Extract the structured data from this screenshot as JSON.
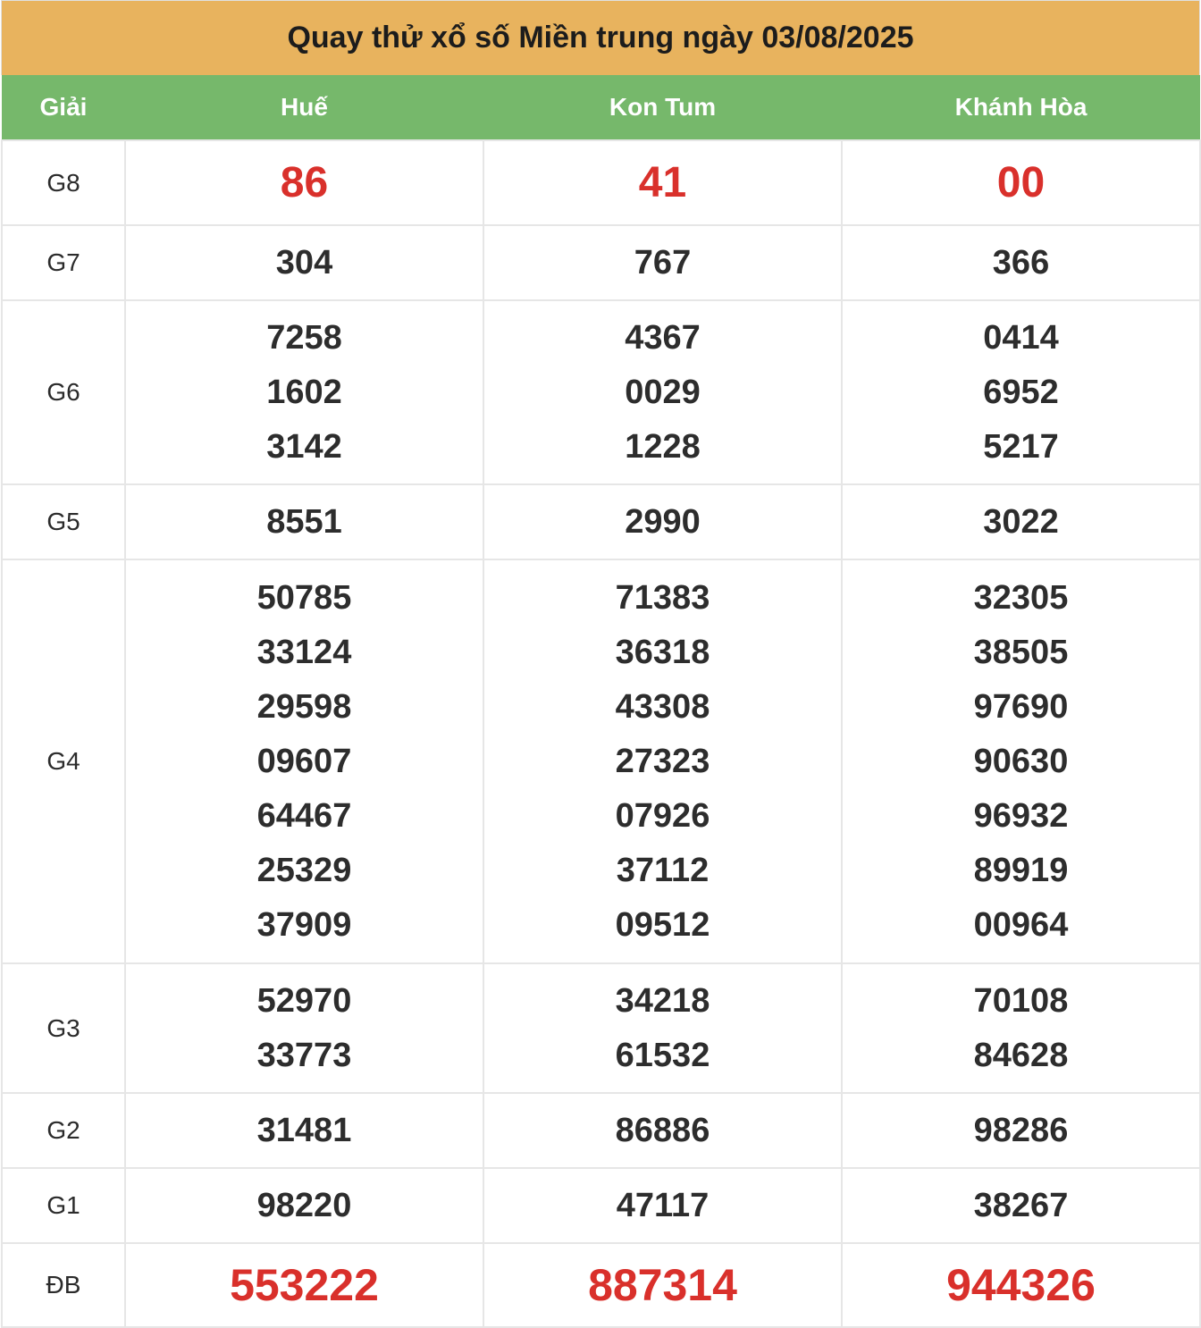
{
  "title": "Quay thử xổ số Miền trung ngày 03/08/2025",
  "headers": {
    "prize": "Giải",
    "provinces": [
      "Huế",
      "Kon Tum",
      "Khánh Hòa"
    ]
  },
  "colors": {
    "title_bg": "#e8b35e",
    "header_bg": "#76b86b",
    "highlight": "#d9302b",
    "text": "#2d2d2d"
  },
  "rows": [
    {
      "prize": "G8",
      "values": [
        [
          "86"
        ],
        [
          "41"
        ],
        [
          "00"
        ]
      ]
    },
    {
      "prize": "G7",
      "values": [
        [
          "304"
        ],
        [
          "767"
        ],
        [
          "366"
        ]
      ]
    },
    {
      "prize": "G6",
      "values": [
        [
          "7258",
          "1602",
          "3142"
        ],
        [
          "4367",
          "0029",
          "1228"
        ],
        [
          "0414",
          "6952",
          "5217"
        ]
      ]
    },
    {
      "prize": "G5",
      "values": [
        [
          "8551"
        ],
        [
          "2990"
        ],
        [
          "3022"
        ]
      ]
    },
    {
      "prize": "G4",
      "values": [
        [
          "50785",
          "33124",
          "29598",
          "09607",
          "64467",
          "25329",
          "37909"
        ],
        [
          "71383",
          "36318",
          "43308",
          "27323",
          "07926",
          "37112",
          "09512"
        ],
        [
          "32305",
          "38505",
          "97690",
          "90630",
          "96932",
          "89919",
          "00964"
        ]
      ]
    },
    {
      "prize": "G3",
      "values": [
        [
          "52970",
          "33773"
        ],
        [
          "34218",
          "61532"
        ],
        [
          "70108",
          "84628"
        ]
      ]
    },
    {
      "prize": "G2",
      "values": [
        [
          "31481"
        ],
        [
          "86886"
        ],
        [
          "98286"
        ]
      ]
    },
    {
      "prize": "G1",
      "values": [
        [
          "98220"
        ],
        [
          "47117"
        ],
        [
          "38267"
        ]
      ]
    },
    {
      "prize": "ĐB",
      "values": [
        [
          "553222"
        ],
        [
          "887314"
        ],
        [
          "944326"
        ]
      ]
    }
  ]
}
